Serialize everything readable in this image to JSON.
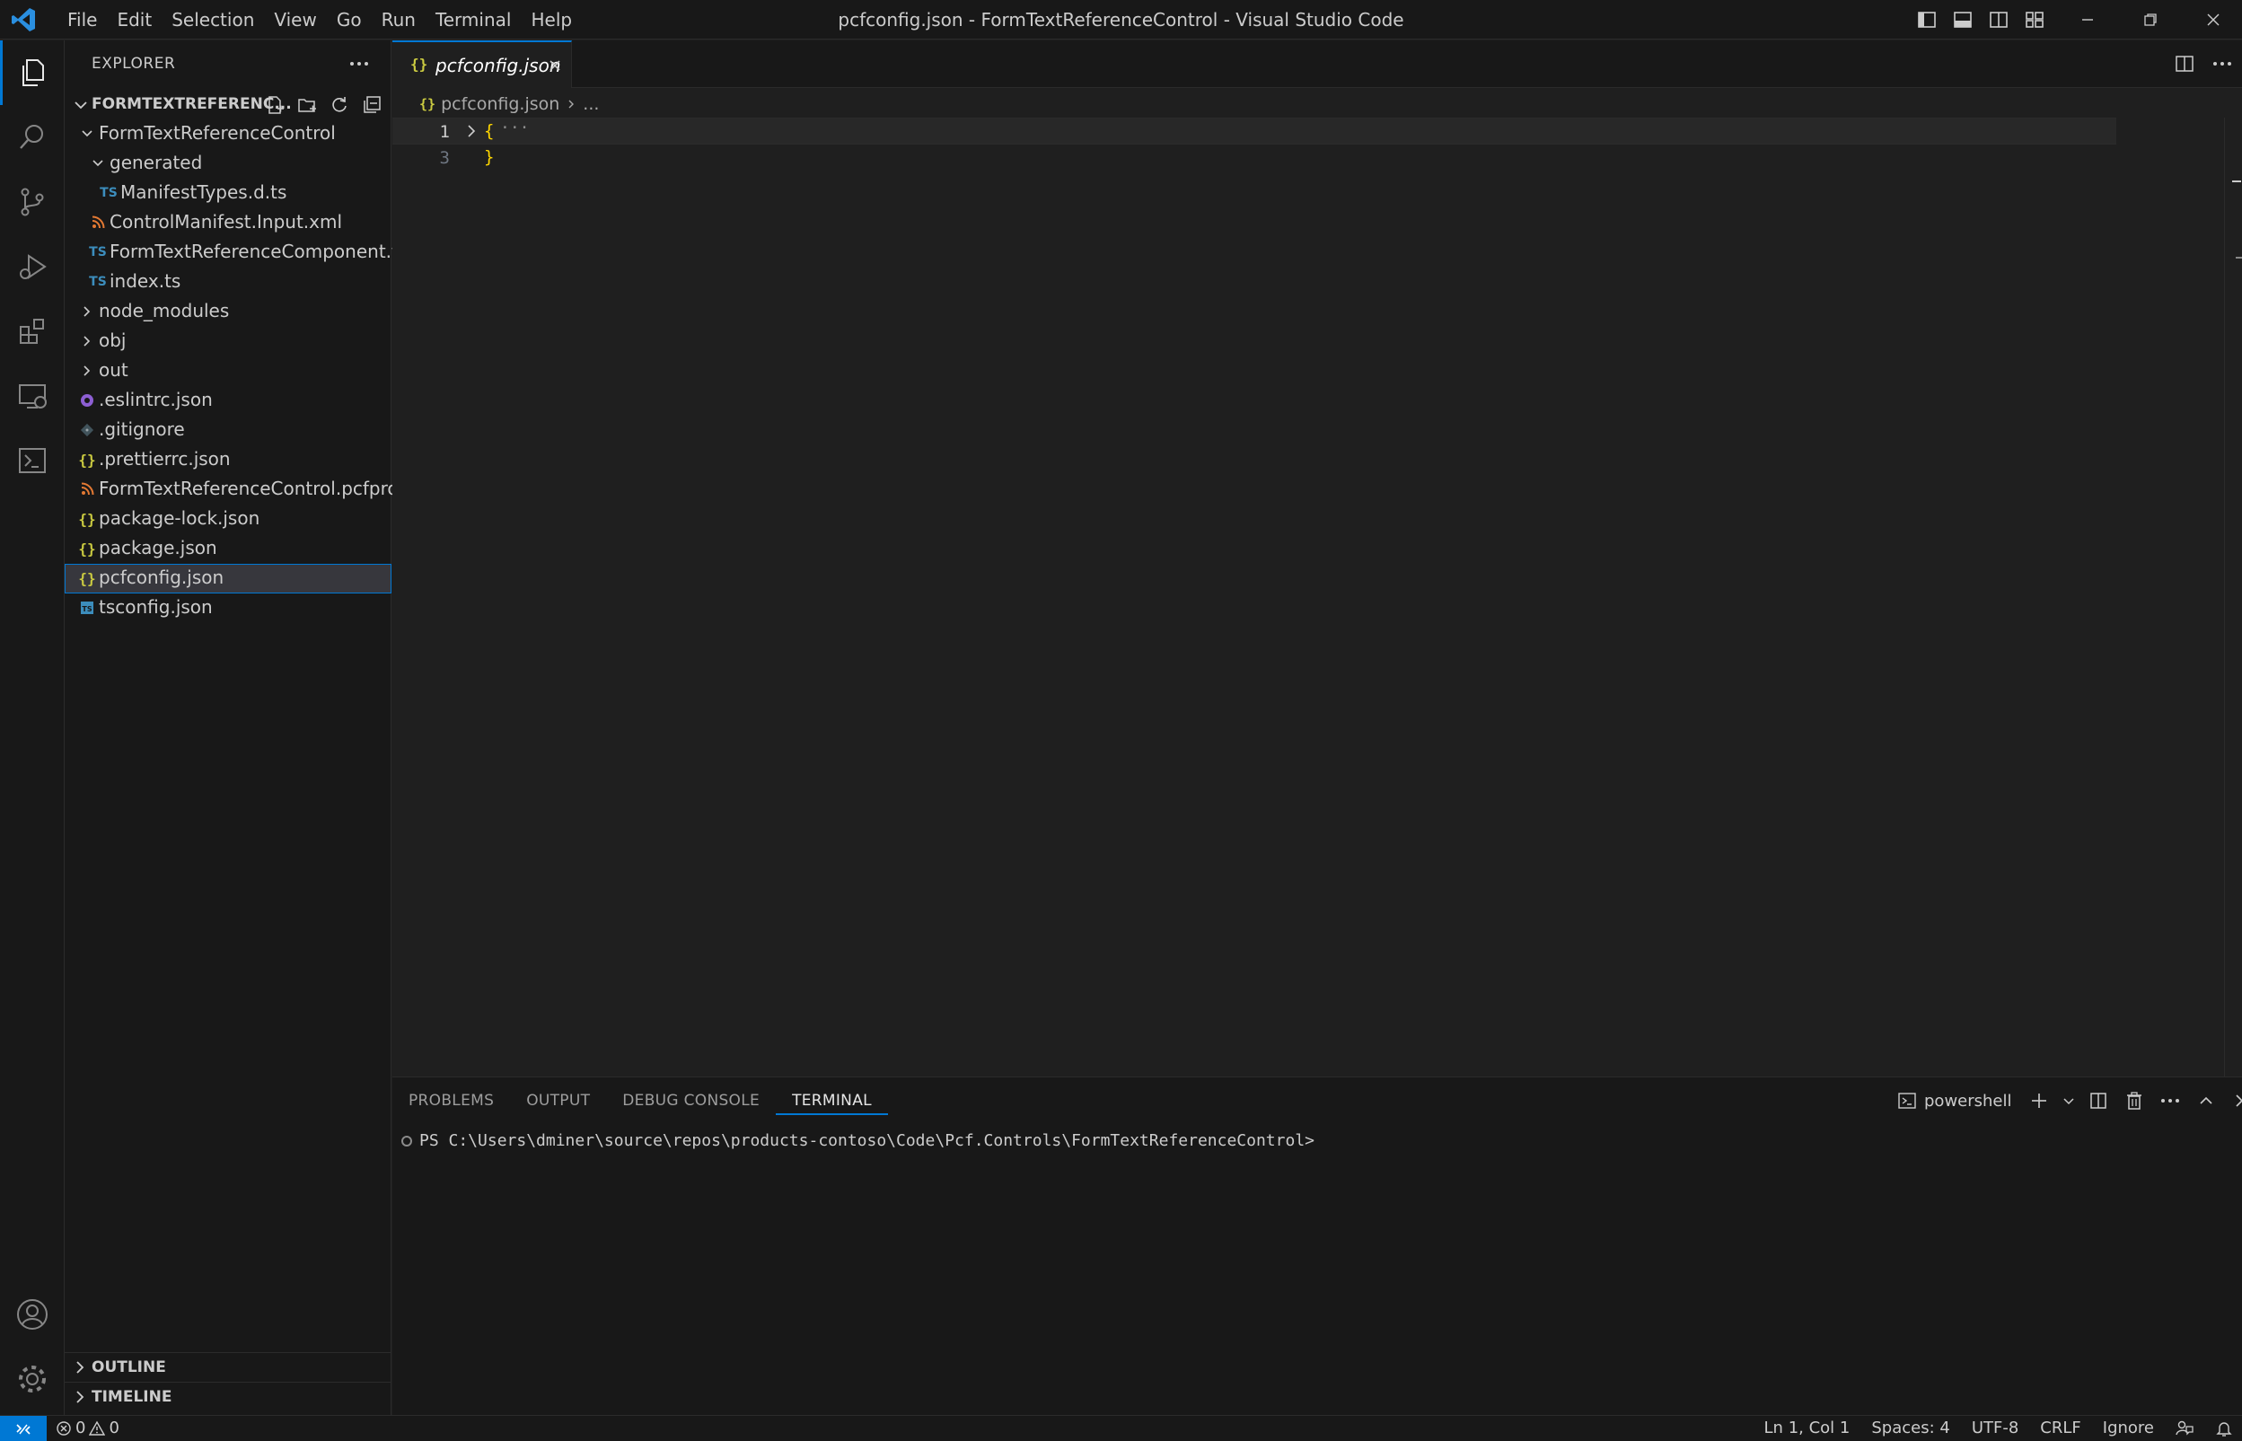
{
  "window": {
    "title": "pcfconfig.json - FormTextReferenceControl - Visual Studio Code"
  },
  "menu": [
    "File",
    "Edit",
    "Selection",
    "View",
    "Go",
    "Run",
    "Terminal",
    "Help"
  ],
  "sidebar": {
    "title": "EXPLORER",
    "project": "FORMTEXTREFERENC...",
    "tree": [
      {
        "label": "FormTextReferenceControl",
        "type": "folder-open",
        "depth": 1
      },
      {
        "label": "generated",
        "type": "folder-open",
        "depth": 2
      },
      {
        "label": "ManifestTypes.d.ts",
        "type": "ts",
        "depth": 3
      },
      {
        "label": "ControlManifest.Input.xml",
        "type": "xml",
        "depth": 2
      },
      {
        "label": "FormTextReferenceComponent.tsx",
        "type": "ts",
        "depth": 2
      },
      {
        "label": "index.ts",
        "type": "ts",
        "depth": 2
      },
      {
        "label": "node_modules",
        "type": "folder",
        "depth": 1
      },
      {
        "label": "obj",
        "type": "folder",
        "depth": 1
      },
      {
        "label": "out",
        "type": "folder",
        "depth": 1
      },
      {
        "label": ".eslintrc.json",
        "type": "eslint",
        "depth": 1
      },
      {
        "label": ".gitignore",
        "type": "git",
        "depth": 1
      },
      {
        "label": ".prettierrc.json",
        "type": "json",
        "depth": 1
      },
      {
        "label": "FormTextReferenceControl.pcfproj",
        "type": "xml",
        "depth": 1
      },
      {
        "label": "package-lock.json",
        "type": "json",
        "depth": 1
      },
      {
        "label": "package.json",
        "type": "json",
        "depth": 1
      },
      {
        "label": "pcfconfig.json",
        "type": "json",
        "depth": 1,
        "selected": true
      },
      {
        "label": "tsconfig.json",
        "type": "tsconfig",
        "depth": 1
      }
    ],
    "outline": "OUTLINE",
    "timeline": "TIMELINE"
  },
  "editor": {
    "tab_label": "pcfconfig.json",
    "breadcrumb_file": "pcfconfig.json",
    "breadcrumb_more": "...",
    "json_glyph": "{}",
    "lines": [
      {
        "no": "1",
        "text": "{",
        "folded": true,
        "ellipsis": "···"
      },
      {
        "no": "3",
        "text": "}"
      }
    ]
  },
  "panel": {
    "tabs": [
      "PROBLEMS",
      "OUTPUT",
      "DEBUG CONSOLE",
      "TERMINAL"
    ],
    "active_tab": "TERMINAL",
    "terminal_profile": "powershell",
    "terminal_prompt": "PS C:\\Users\\dminer\\source\\repos\\products-contoso\\Code\\Pcf.Controls\\FormTextReferenceControl>"
  },
  "status": {
    "errors": "0",
    "warnings": "0",
    "position": "Ln 1, Col 1",
    "spaces": "Spaces: 4",
    "encoding": "UTF-8",
    "eol": "CRLF",
    "ignore": "Ignore"
  },
  "colors": {
    "accent": "#0078d4",
    "json": "#cbcb41",
    "ts": "#3c8dbc",
    "xml": "#e37933"
  }
}
